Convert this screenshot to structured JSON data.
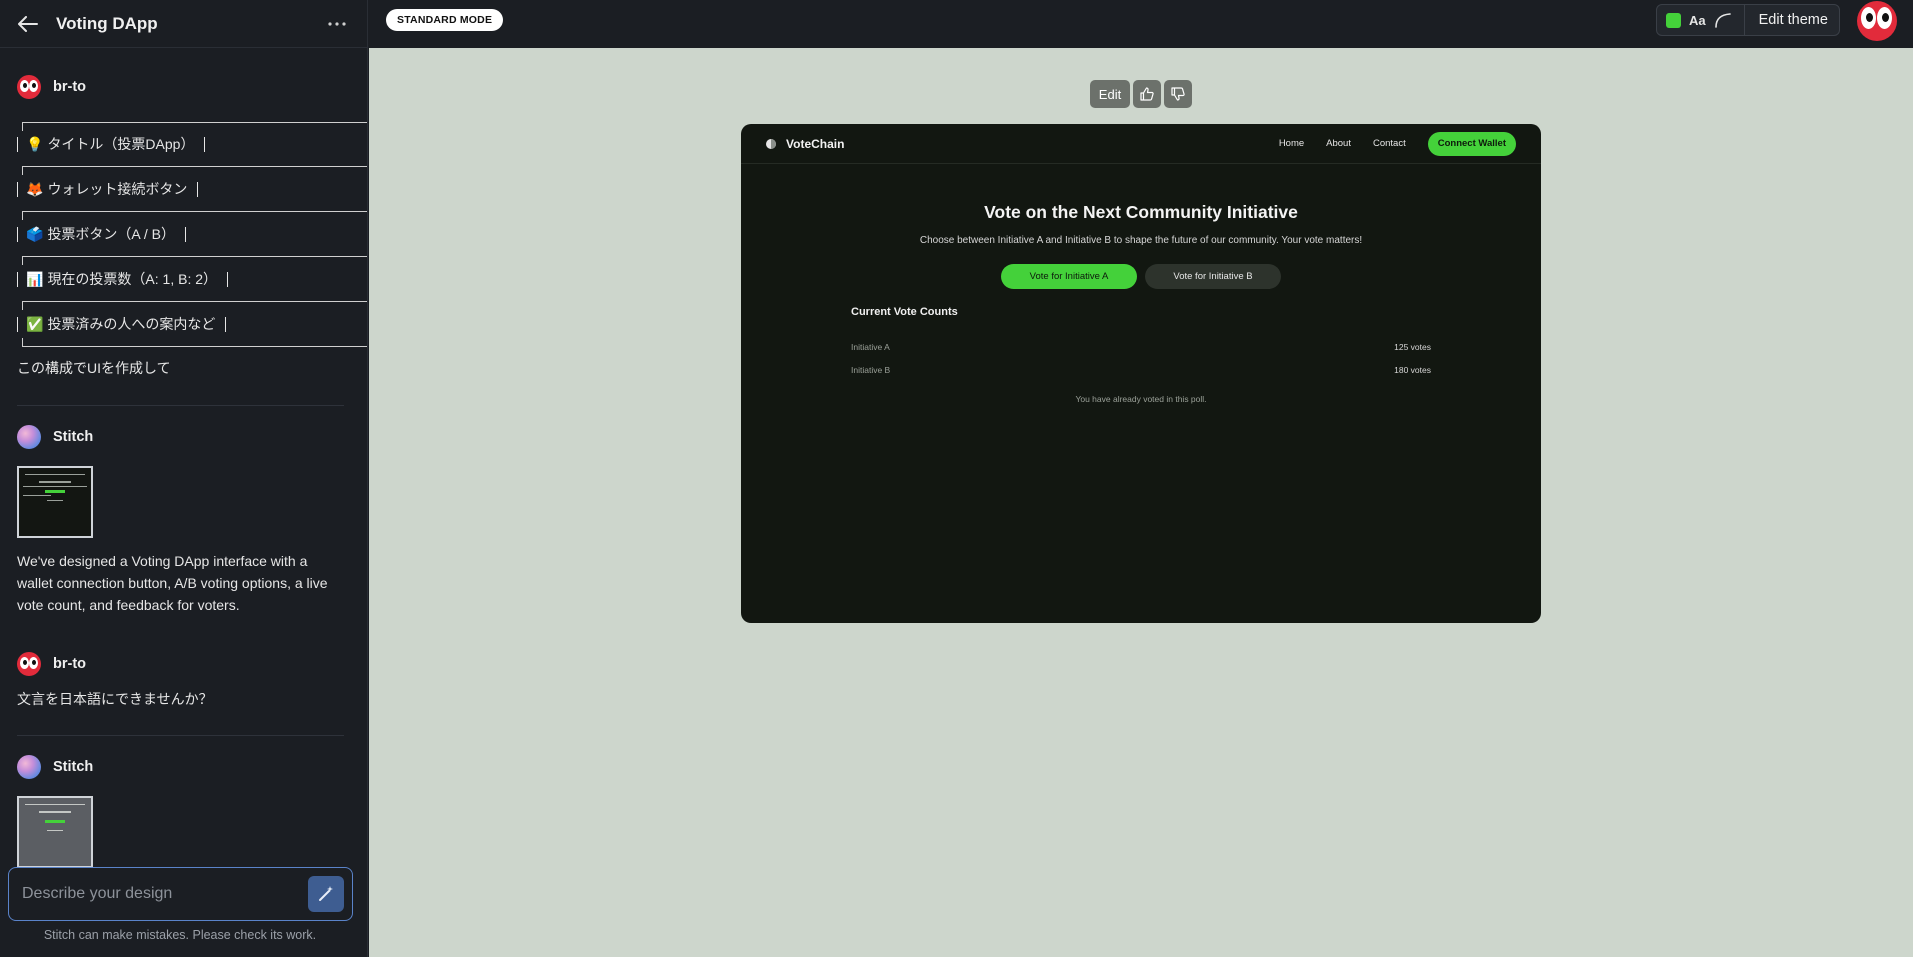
{
  "app": {
    "title": "Voting DApp",
    "mode_label": "STANDARD MODE",
    "edit_theme_label": "Edit theme",
    "theme_font_label": "Aa",
    "accent_color": "#44d13a"
  },
  "chat": {
    "messages": [
      {
        "author": "br-to",
        "tree": [
          {
            "emoji": "💡",
            "text": "タイトル（投票DApp）"
          },
          {
            "emoji": "🦊",
            "text": "ウォレット接続ボタン"
          },
          {
            "emoji": "🗳️",
            "text": "投票ボタン（A / B）"
          },
          {
            "emoji": "📊",
            "text": "現在の投票数（A: 1, B: 2）"
          },
          {
            "emoji": "✅",
            "text": "投票済みの人への案内など"
          }
        ],
        "text": "この構成でUIを作成して"
      },
      {
        "author": "Stitch",
        "text": "We've designed a Voting DApp interface with a wallet connection button, A/B voting options, a live vote count, and feedback for voters."
      },
      {
        "author": "br-to",
        "text": "文言を日本語にできませんか？"
      },
      {
        "author": "Stitch"
      }
    ],
    "composer_placeholder": "Describe your design",
    "disclaimer": "Stitch can make mistakes. Please check its work."
  },
  "canvas": {
    "toolbar": {
      "edit_label": "Edit"
    },
    "preview": {
      "brand": "VoteChain",
      "nav": [
        "Home",
        "About",
        "Contact"
      ],
      "connect_label": "Connect Wallet",
      "hero_title": "Vote on the Next Community Initiative",
      "hero_subtitle": "Choose between Initiative A and Initiative B to shape the future of our community. Your vote matters!",
      "vote_a_label": "Vote for Initiative A",
      "vote_b_label": "Vote for Initiative B",
      "counts_title": "Current Vote Counts",
      "counts": [
        {
          "label": "Initiative A",
          "value": "125 votes"
        },
        {
          "label": "Initiative B",
          "value": "180 votes"
        }
      ],
      "note": "You have already voted in this poll."
    }
  }
}
